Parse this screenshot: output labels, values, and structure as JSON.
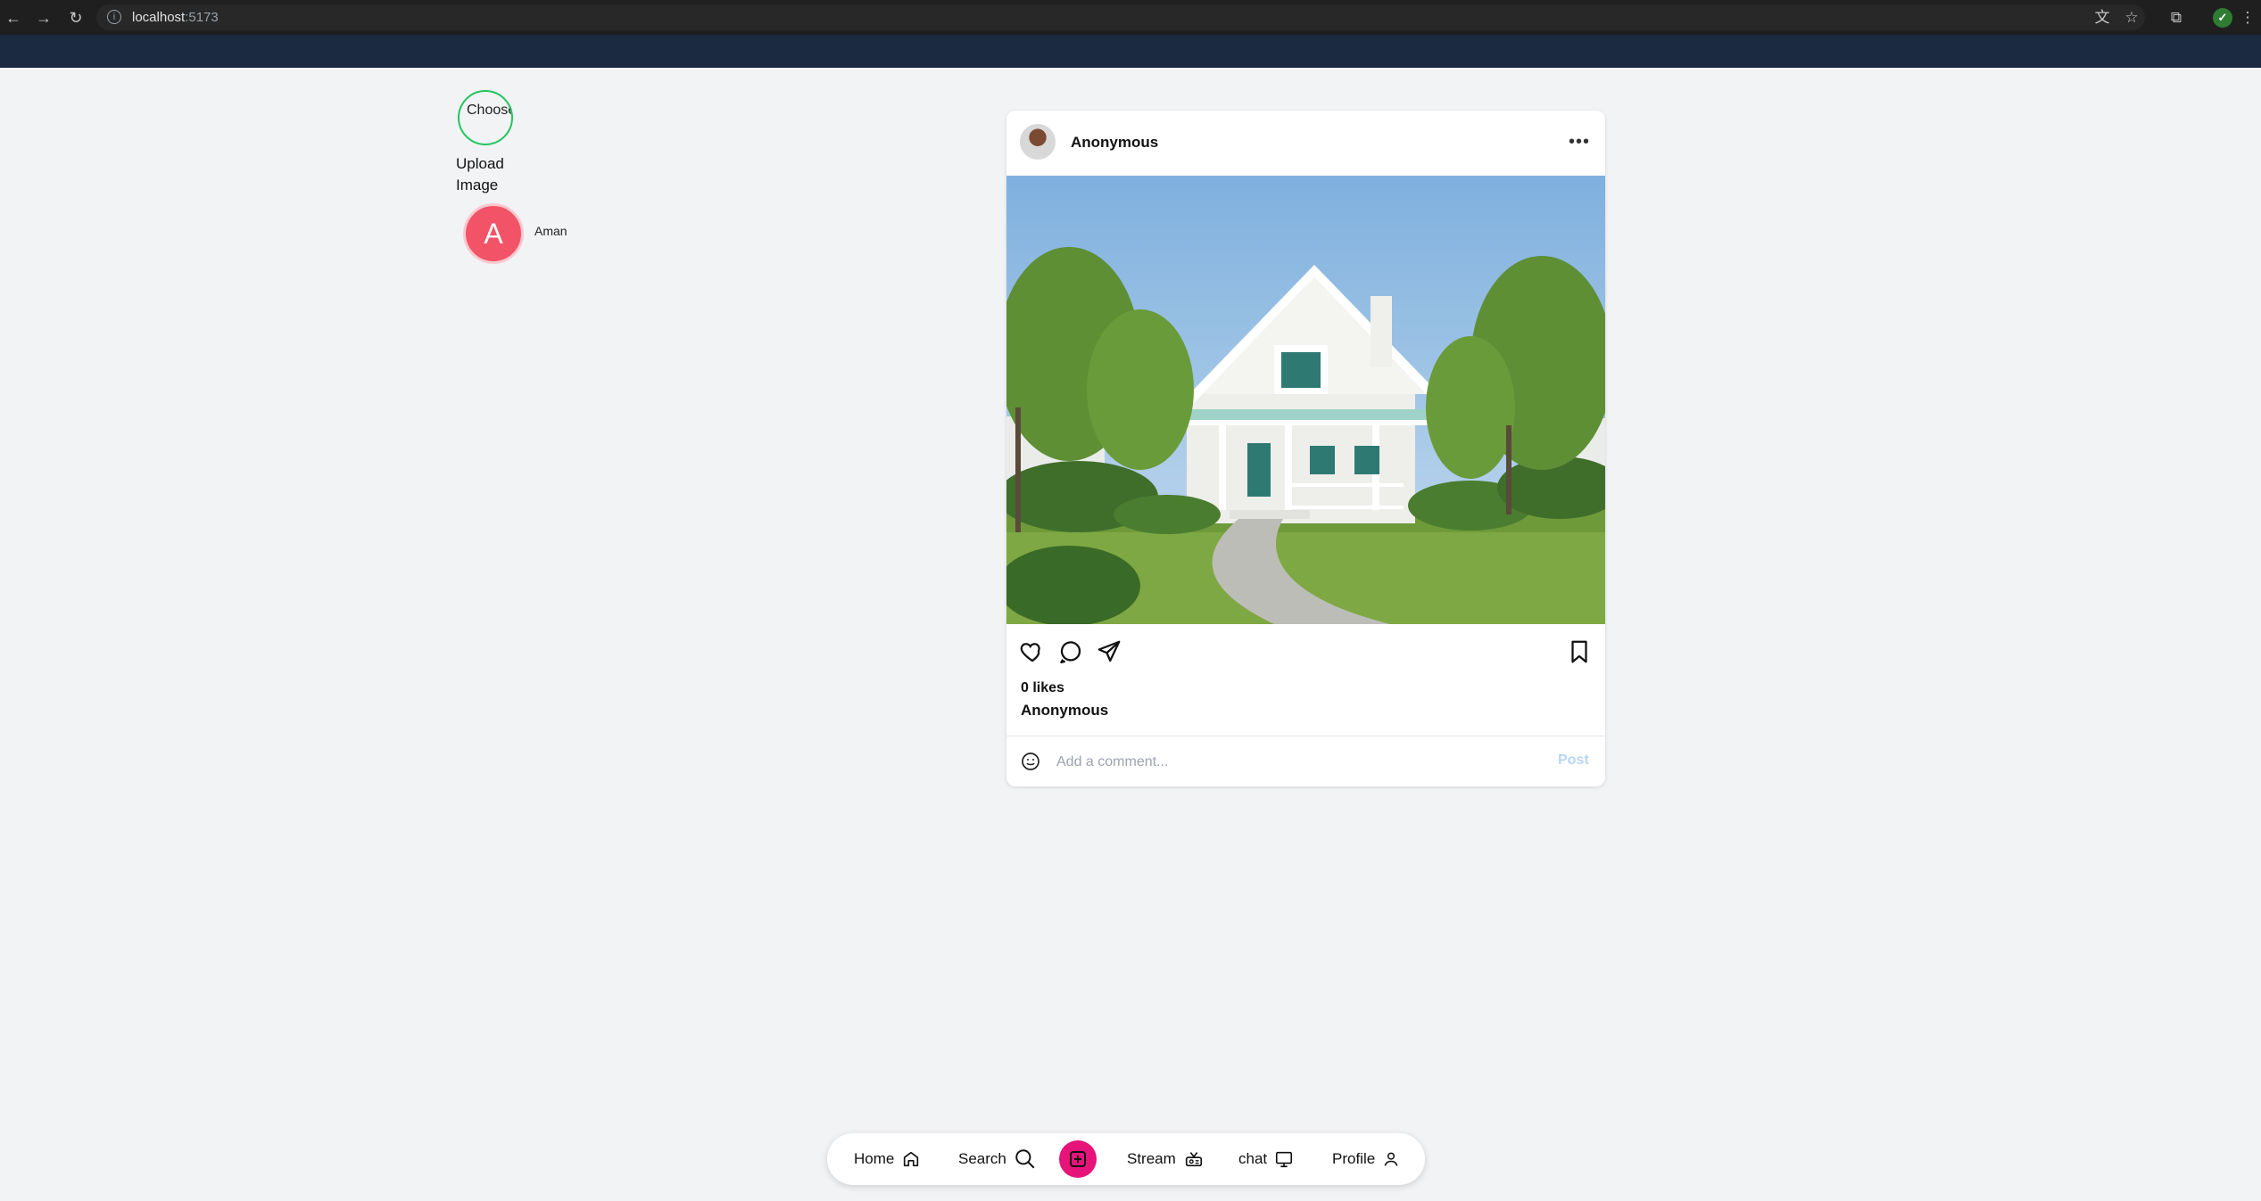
{
  "browser": {
    "url_host": "localhost",
    "url_port": ":5173",
    "profile_initial": "✓"
  },
  "upload": {
    "choose_label": "Choose File",
    "upload_label": "Upload Image"
  },
  "stories": [
    {
      "initial": "A",
      "name": "Aman"
    }
  ],
  "post": {
    "username": "Anonymous",
    "image_alt": "White two-story house with front porch and garden path",
    "likes": "0 likes",
    "caption_user": "Anonymous",
    "comment_placeholder": "Add a comment...",
    "post_button": "Post",
    "more_icon": "more-horizontal-icon"
  },
  "bottom_nav": {
    "home": "Home",
    "search": "Search",
    "stream": "Stream",
    "chat": "chat",
    "profile": "Profile"
  },
  "colors": {
    "accent_pink": "#e5137a",
    "story_red": "#f25367",
    "upload_green": "#22c55e",
    "header_navy": "#1b2a41"
  }
}
